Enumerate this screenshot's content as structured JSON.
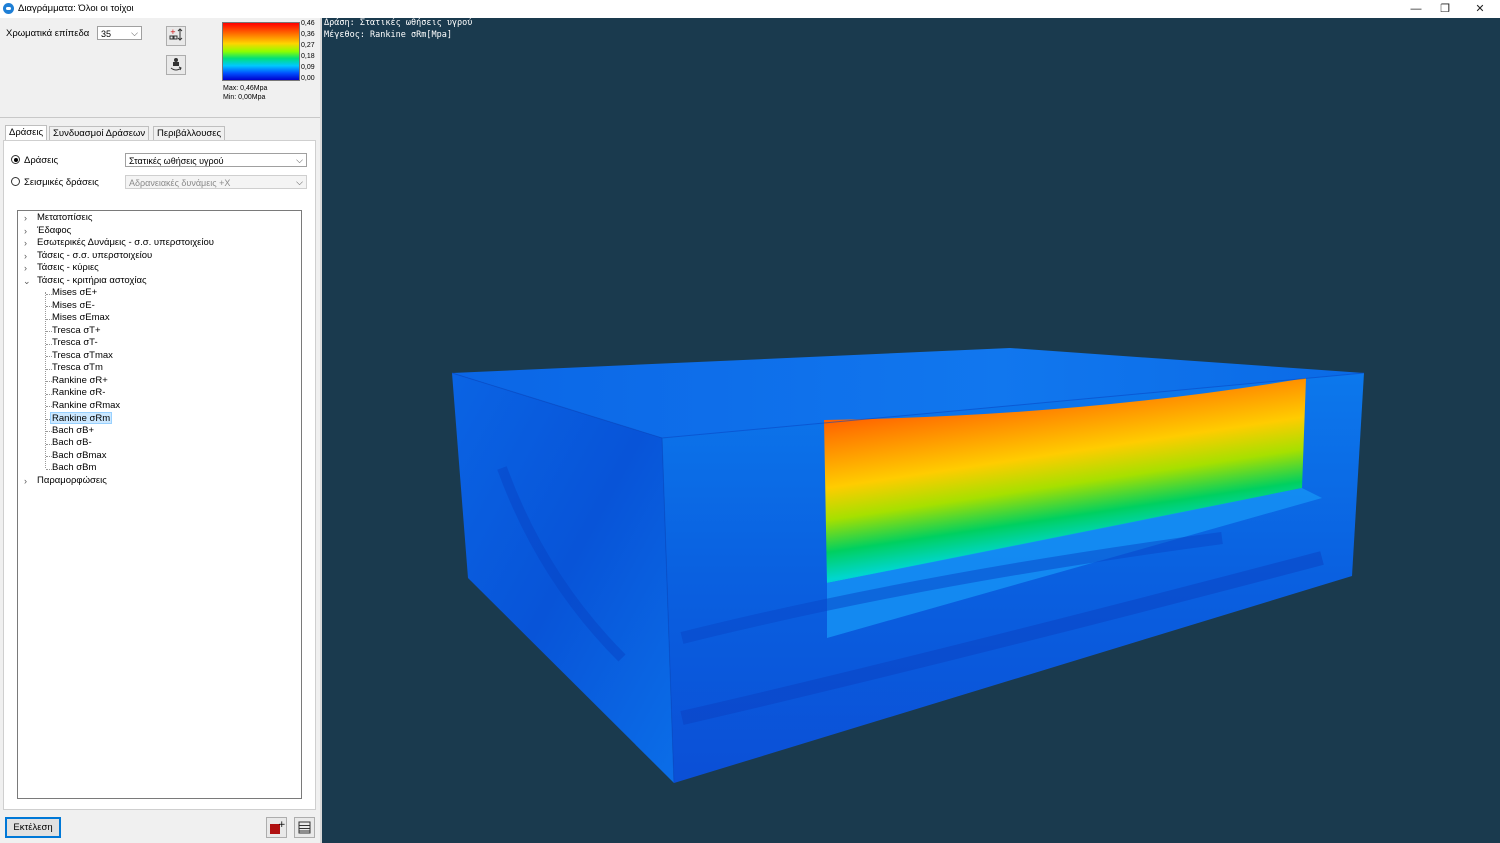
{
  "window": {
    "title": "Διαγράμματα: Όλοι οι τοίχοι"
  },
  "controls": {
    "color_levels_label": "Χρωματικά επίπεδα",
    "color_levels_value": "35"
  },
  "legend": {
    "ticks": [
      "0,46",
      "0,36",
      "0,27",
      "0,18",
      "0,09",
      "0,00"
    ],
    "max": "Max: 0,46Mpa",
    "min": "Min: 0,00Mpa"
  },
  "tabs": [
    "Δράσεις",
    "Συνδυασμοί Δράσεων",
    "Περιβάλλουσες"
  ],
  "actions": {
    "radio1_label": "Δράσεις",
    "radio1_value": "Στατικές ωθήσεις υγρού",
    "radio2_label": "Σεισμικές δράσεις",
    "radio2_value": "Αδρανειακές δυνάμεις +X"
  },
  "tree": {
    "items": [
      "Μετατοπίσεις",
      "Έδαφος",
      "Εσωτερικές Δυνάμεις - σ.σ. υπερστοιχείου",
      "Τάσεις - σ.σ. υπερστοιχείου",
      "Τάσεις - κύριες",
      "Τάσεις - κριτήρια αστοχίας",
      "Παραμορφώσεις"
    ],
    "children": [
      "Mises σE+",
      "Mises σE-",
      "Mises σEmax",
      "Tresca σT+",
      "Tresca σT-",
      "Tresca σTmax",
      "Tresca σTm",
      "Rankine σR+",
      "Rankine σR-",
      "Rankine σRmax",
      "Rankine σRm",
      "Bach σB+",
      "Bach σB-",
      "Bach σBmax",
      "Bach σBm"
    ],
    "selected": "Rankine σRm"
  },
  "buttons": {
    "run": "Εκτέλεση"
  },
  "viewport": {
    "line1": "Δράση: Στατικές ωθήσεις υγρού",
    "line2": "Μέγεθος: Rankine σRm[Mpa]",
    "background": "#1a3a4e"
  },
  "colors": {
    "accent": "#0078d7",
    "selection": "#cce8ff"
  }
}
